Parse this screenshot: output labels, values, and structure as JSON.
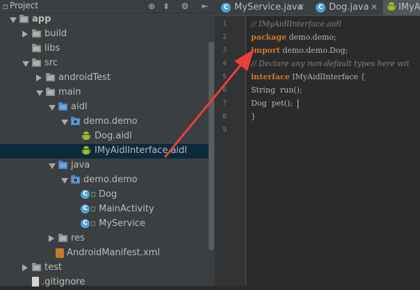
{
  "project_panel": {
    "title": "Project",
    "header_icons": [
      "target-icon",
      "split-icon",
      "gear-icon",
      "hide-panel-icon"
    ]
  },
  "tree": [
    {
      "name": "app",
      "expanded": true,
      "type": "module",
      "bold": true
    },
    {
      "name": "build",
      "expanded": false,
      "type": "folder"
    },
    {
      "name": "libs",
      "type": "folder"
    },
    {
      "name": "src",
      "expanded": true,
      "type": "folder"
    },
    {
      "name": "androidTest",
      "expanded": false,
      "type": "folder"
    },
    {
      "name": "main",
      "expanded": true,
      "type": "folder"
    },
    {
      "name": "aidl",
      "expanded": true,
      "type": "source-folder"
    },
    {
      "name": "demo.demo",
      "expanded": true,
      "type": "package"
    },
    {
      "name": "Dog.aidl",
      "type": "aidl-file"
    },
    {
      "name": "IMyAidlInterface.aidl",
      "type": "aidl-file",
      "selected": true
    },
    {
      "name": "java",
      "expanded": true,
      "type": "source-folder"
    },
    {
      "name": "demo.demo",
      "expanded": true,
      "type": "package"
    },
    {
      "name": "Dog",
      "type": "class"
    },
    {
      "name": "MainActivity",
      "type": "class"
    },
    {
      "name": "MyService",
      "type": "class"
    },
    {
      "name": "res",
      "expanded": false,
      "type": "folder"
    },
    {
      "name": "AndroidManifest.xml",
      "type": "xml-file"
    },
    {
      "name": "test",
      "expanded": false,
      "type": "folder"
    },
    {
      "name": ".gitignore",
      "type": "file"
    }
  ],
  "tabs": [
    {
      "label": "MyService.java",
      "icon": "C"
    },
    {
      "label": "Dog.java",
      "icon": "C"
    },
    {
      "label": "IMyA",
      "active": true
    }
  ],
  "line_numbers": [
    "1",
    "2",
    "3",
    "4",
    "5",
    "6",
    "7",
    "8",
    "9"
  ],
  "code_lines": [
    {
      "parts": [
        {
          "t": "// IMyAidlInterface.aidl",
          "c": "comment"
        }
      ]
    },
    {
      "parts": [
        {
          "t": "package",
          "c": "kw"
        },
        {
          "t": " demo.demo;",
          "c": "tx"
        }
      ]
    },
    {
      "parts": [
        {
          "t": "import",
          "c": "kw"
        },
        {
          "t": " demo.demo.Dog;",
          "c": "tx"
        }
      ]
    },
    {
      "parts": [
        {
          "t": "// Declare any non-default types here wit",
          "c": "comment"
        }
      ]
    },
    {
      "parts": [
        {
          "t": "interface",
          "c": "kw"
        },
        {
          "t": " IMyAidlInterface {",
          "c": "tx"
        }
      ]
    },
    {
      "parts": [
        {
          "t": "String  run();",
          "c": "tx"
        }
      ]
    },
    {
      "parts": [
        {
          "t": "Dog  pet();",
          "c": "tx"
        }
      ]
    },
    {
      "parts": [
        {
          "t": "}",
          "c": "tx"
        }
      ]
    },
    {
      "parts": []
    }
  ],
  "colors": {
    "panel_bg": "#3c3f41",
    "editor_bg": "#2b2b2b",
    "selection": "#0d293e",
    "keyword": "#cc7832",
    "comment": "#808080",
    "annotation_arrow": "#e8413b"
  }
}
